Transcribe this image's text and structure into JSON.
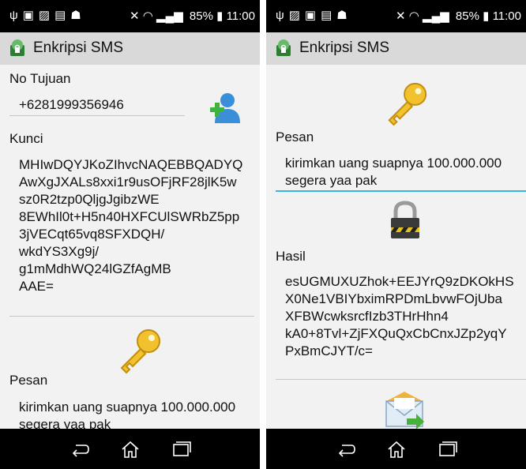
{
  "status_bar": {
    "battery_percent": "85%",
    "time": "11:00"
  },
  "app": {
    "title": "Enkripsi SMS"
  },
  "left_screen": {
    "no_tujuan_label": "No Tujuan",
    "phone_number": "+6281999356946",
    "kunci_label": "Kunci",
    "kunci_lines": [
      "MHIwDQYJKoZIhvcNAQEBBQADYQ",
      "AwXgJXALs8xxi1r9usOFjRF28jlK5w",
      "sz0R2tzp0QljgJgibzWE",
      "8EWhIl0t+H5n40HXFCUlSWRbZ5pp",
      "3jVECqt65vq8SFXDQH/",
      "wkdYS3Xg9j/",
      "g1mMdhWQ24lGZfAgMB",
      "AAE="
    ],
    "pesan_label": "Pesan",
    "pesan_lines": [
      "kirimkan uang suapnya 100.000.000",
      "segera yaa pak"
    ]
  },
  "right_screen": {
    "pesan_label": "Pesan",
    "pesan_lines": [
      "kirimkan uang suapnya 100.000.000",
      "segera yaa pak"
    ],
    "hasil_label": "Hasil",
    "hasil_lines": [
      "esUGMUXUZhok+EEJYrQ9zDKOkHS",
      "X0Ne1VBIYbximRPDmLbvwFOjUba",
      "XFBWcwksrcfIzb3THrHhn4",
      "kA0+8Tvl+ZjFXQuQxCbCnxJZp2yqY",
      "PxBmCJYT/c="
    ]
  },
  "icons": [
    "usb-icon",
    "picture-icon",
    "chat-icon",
    "android-icon",
    "vibrate-icon",
    "wifi-icon",
    "signal-icon",
    "battery-icon",
    "add-contact-icon",
    "key-icon",
    "padlock-icon",
    "send-message-icon",
    "back-icon",
    "home-icon",
    "recent-apps-icon"
  ]
}
